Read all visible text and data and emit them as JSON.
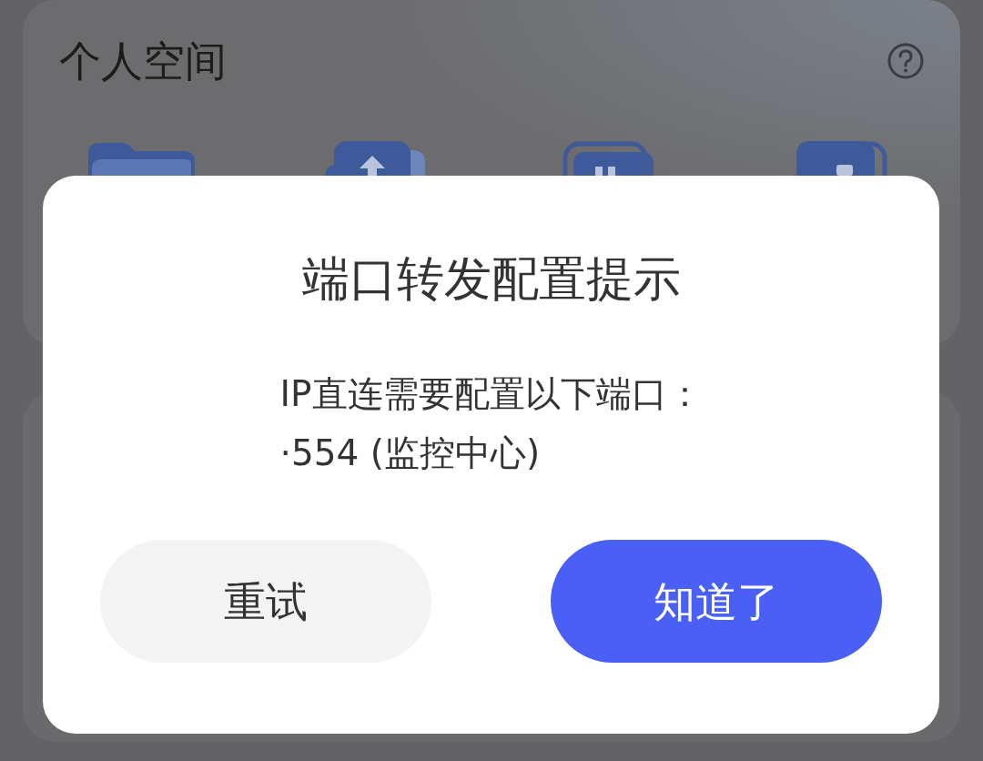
{
  "background": {
    "section_title": "个人空间",
    "shortcuts": [
      {
        "kind": "folder"
      },
      {
        "kind": "upload"
      },
      {
        "kind": "stack"
      },
      {
        "kind": "tile"
      }
    ]
  },
  "dialog": {
    "title": "端口转发配置提示",
    "message": "IP直连需要配置以下端口：",
    "ports": [
      "·554 (监控中心)"
    ],
    "buttons": [
      {
        "label": "重试",
        "kind": "secondary"
      },
      {
        "label": "知道了",
        "kind": "primary"
      }
    ]
  }
}
